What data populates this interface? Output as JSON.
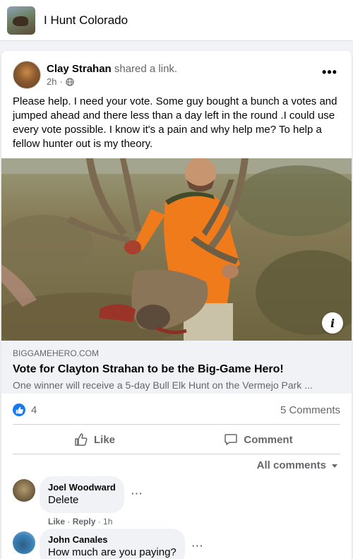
{
  "group": {
    "name": "I Hunt Colorado"
  },
  "post": {
    "author": "Clay Strahan",
    "action": "shared a link.",
    "time": "2h",
    "text": "Please help. I need your vote. Some guy bought a bunch a votes and jumped ahead and there less than a day left in the round .I could use every vote possible. I know it's a pain and why help me? To help a fellow hunter out is my theory.",
    "link": {
      "domain": "BIGGAMEHERO.COM",
      "title": "Vote for Clayton Strahan to be the Big-Game Hero!",
      "description": "One winner will receive a 5-day Bull Elk Hunt on the Vermejo Park ..."
    },
    "reaction_count": "4",
    "comment_count": "5 Comments",
    "actions": {
      "like": "Like",
      "comment": "Comment"
    },
    "comments_filter": "All comments"
  },
  "comments": [
    {
      "author": "Joel Woodward",
      "text": "Delete",
      "like": "Like",
      "reply": "Reply",
      "time": "1h"
    },
    {
      "author": "John Canales",
      "text": "How much are you paying?"
    }
  ],
  "colors": {
    "accent": "#1877f2",
    "secondary_text": "#65676b",
    "bubble": "#f0f2f5"
  }
}
